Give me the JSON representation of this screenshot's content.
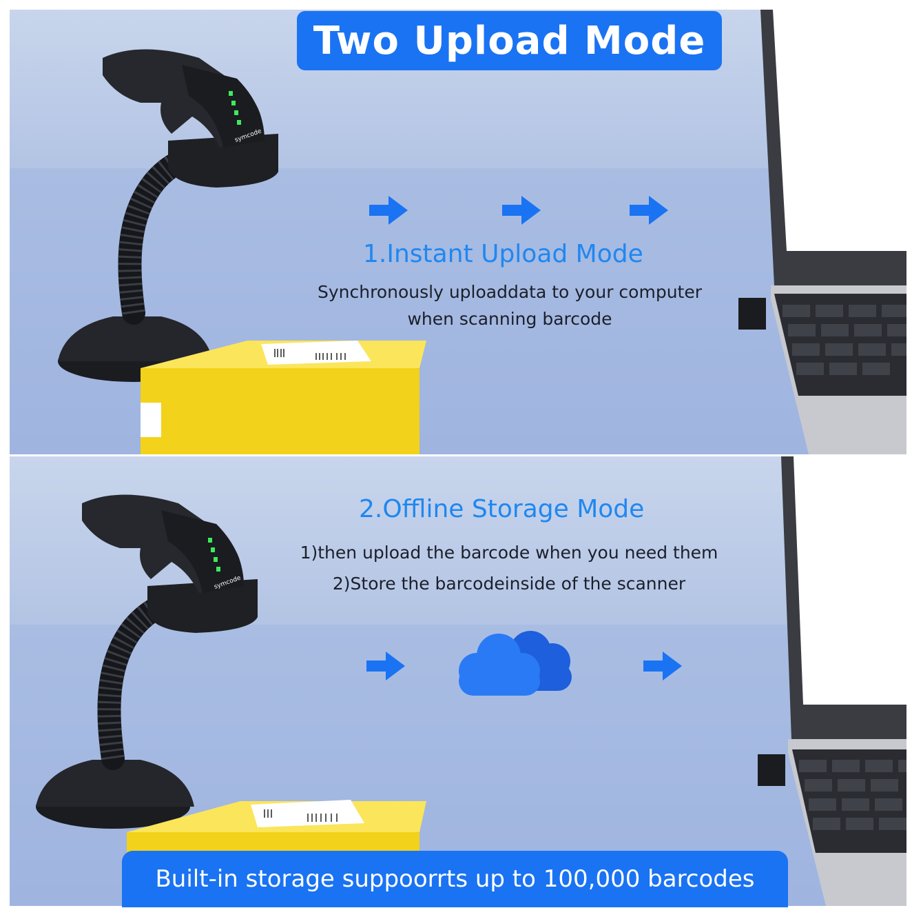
{
  "title": "Two Upload Mode",
  "modes": [
    {
      "title": "1.Instant Upload Mode",
      "lines": [
        "Synchronously uploaddata to your computer",
        "when scanning barcode"
      ]
    },
    {
      "title": "2.Offline Storage Mode",
      "lines": [
        "1)then upload the barcode when you need them",
        "2)Store the barcodeinside of the scanner"
      ]
    }
  ],
  "scanner_brand": "symcode",
  "banner": "Built-in storage suppoorrts up to 100,000 barcodes",
  "colors": {
    "accent_blue": "#1a73f2",
    "mode_title_blue": "#1f87f0",
    "background_wall": "#c8d5ec",
    "background_floor": "#a9bde3",
    "box_yellow": "#f7d92a"
  },
  "icons": [
    "arrow-right-icon",
    "cloud-icon",
    "barcode-scanner",
    "laptop",
    "usb-receiver",
    "package-box"
  ]
}
